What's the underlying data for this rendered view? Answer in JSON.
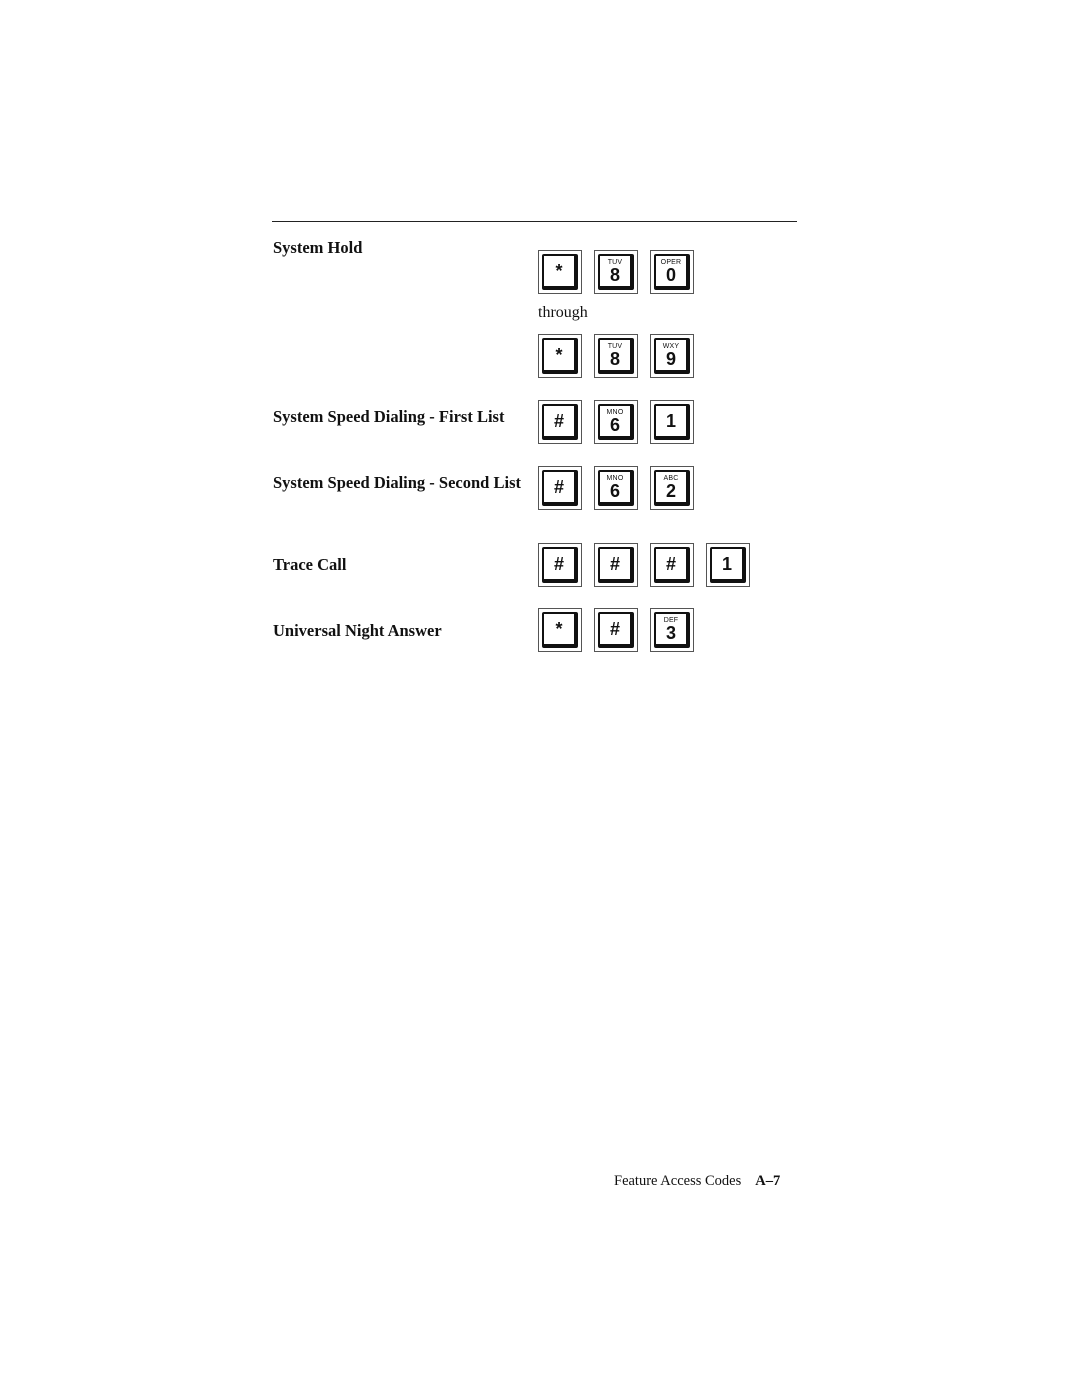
{
  "sections": [
    {
      "label": "System Hold",
      "keys": [
        {
          "main": "*",
          "letters": ""
        },
        {
          "main": "8",
          "letters": "TUV"
        },
        {
          "main": "0",
          "letters": "OPER"
        }
      ]
    },
    {
      "label": "System Speed Dialing - First List",
      "keys": [
        {
          "main": "#",
          "letters": ""
        },
        {
          "main": "6",
          "letters": "MNO"
        },
        {
          "main": "1",
          "letters": ""
        }
      ]
    },
    {
      "label": "System Speed Dialing - Second List",
      "keys": [
        {
          "main": "#",
          "letters": ""
        },
        {
          "main": "6",
          "letters": "MNO"
        },
        {
          "main": "2",
          "letters": "ABC"
        }
      ]
    },
    {
      "label": "Trace Call",
      "keys": [
        {
          "main": "#",
          "letters": ""
        },
        {
          "main": "#",
          "letters": ""
        },
        {
          "main": "#",
          "letters": ""
        },
        {
          "main": "1",
          "letters": ""
        }
      ]
    },
    {
      "label": "Universal Night Answer",
      "keys": [
        {
          "main": "*",
          "letters": ""
        },
        {
          "main": "#",
          "letters": ""
        },
        {
          "main": "3",
          "letters": "DEF"
        }
      ]
    }
  ],
  "system_hold_through": {
    "text": "through",
    "keys": [
      {
        "main": "*",
        "letters": ""
      },
      {
        "main": "8",
        "letters": "TUV"
      },
      {
        "main": "9",
        "letters": "WXY"
      }
    ]
  },
  "footer": {
    "title": "Feature Access Codes",
    "page": "A–7"
  }
}
